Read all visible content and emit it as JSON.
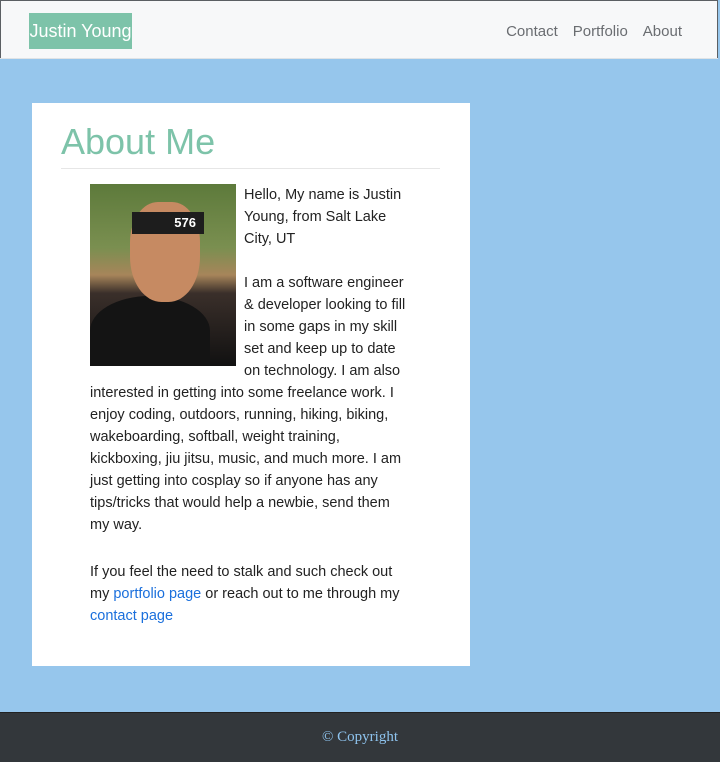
{
  "navbar": {
    "brand": "Justin Young",
    "links": [
      "Contact",
      "Portfolio",
      "About"
    ]
  },
  "about": {
    "title": "About Me",
    "photo_number": "576",
    "intro": "Hello, My name is Justin Young, from Salt Lake City, UT",
    "bio": "I am a software engineer & developer looking to fill in some gaps in my skill set and keep up to date on technology. I am also interested in getting into some freelance work. I enjoy coding, outdoors, running, hiking, biking, wakeboarding, softball, weight training, kickboxing, jiu jitsu, music, and much more. I am just getting into cosplay so if anyone has any tips/tricks that would help a newbie, send them my way.",
    "contact_text_1": "If you feel the need to stalk and such check out my ",
    "portfolio_link": "portfolio page",
    "contact_text_2": " or reach out to me through my ",
    "contact_link": "contact page"
  },
  "footer": {
    "copyright": "© Copyright"
  },
  "colors": {
    "accent": "#7dc3a9",
    "page_background": "#96c6ec",
    "link": "#1a6fdc",
    "footer_background": "#33373b"
  }
}
